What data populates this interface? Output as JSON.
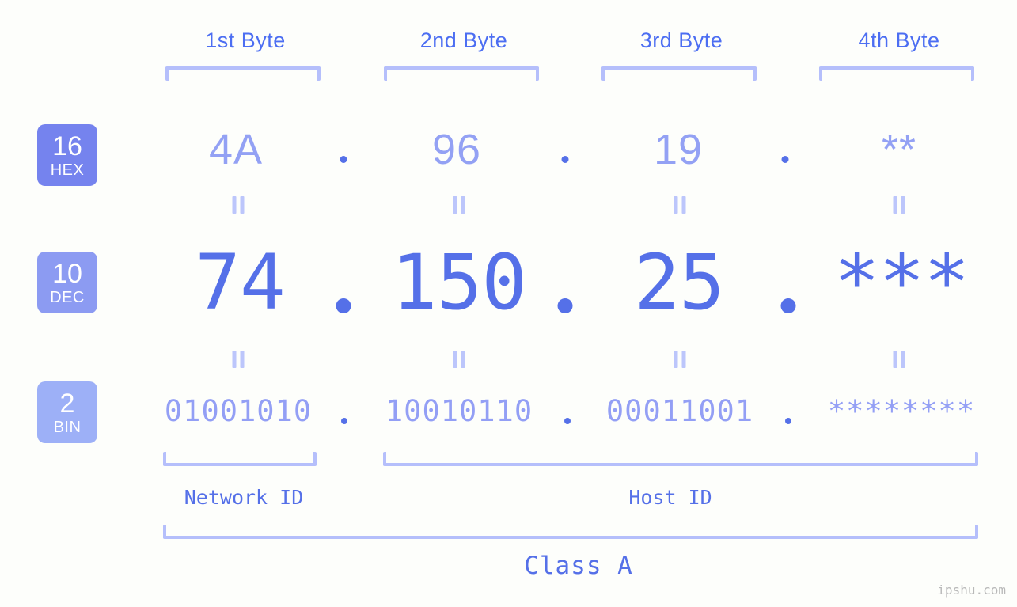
{
  "meta": {
    "background_color": "#fdfefb",
    "accent_color": "#5570e8",
    "bracket_color": "#b5bffb",
    "watermark": "ipshu.com"
  },
  "byte_headers": [
    {
      "label": "1st Byte"
    },
    {
      "label": "2nd Byte"
    },
    {
      "label": "3rd Byte"
    },
    {
      "label": "4th Byte"
    }
  ],
  "bases": [
    {
      "number": "16",
      "name": "HEX",
      "color": "#7583ee"
    },
    {
      "number": "10",
      "name": "DEC",
      "color": "#8c9bf2"
    },
    {
      "number": "2",
      "name": "BIN",
      "color": "#9db0f7"
    }
  ],
  "rows": {
    "hex": {
      "base_number": "16",
      "base_name": "HEX",
      "values": [
        "4A",
        "96",
        "19",
        "**"
      ],
      "separator": "."
    },
    "dec": {
      "base_number": "10",
      "base_name": "DEC",
      "values": [
        "74",
        "150",
        "25",
        "***"
      ],
      "separator": "."
    },
    "bin": {
      "base_number": "2",
      "base_name": "BIN",
      "values": [
        "01001010",
        "10010110",
        "00011001",
        "********"
      ],
      "separator": "."
    }
  },
  "connectors": {
    "symbol": "||",
    "count_per_row": 4
  },
  "sections": {
    "network_id": "Network ID",
    "host_id": "Host ID",
    "class": "Class A"
  }
}
